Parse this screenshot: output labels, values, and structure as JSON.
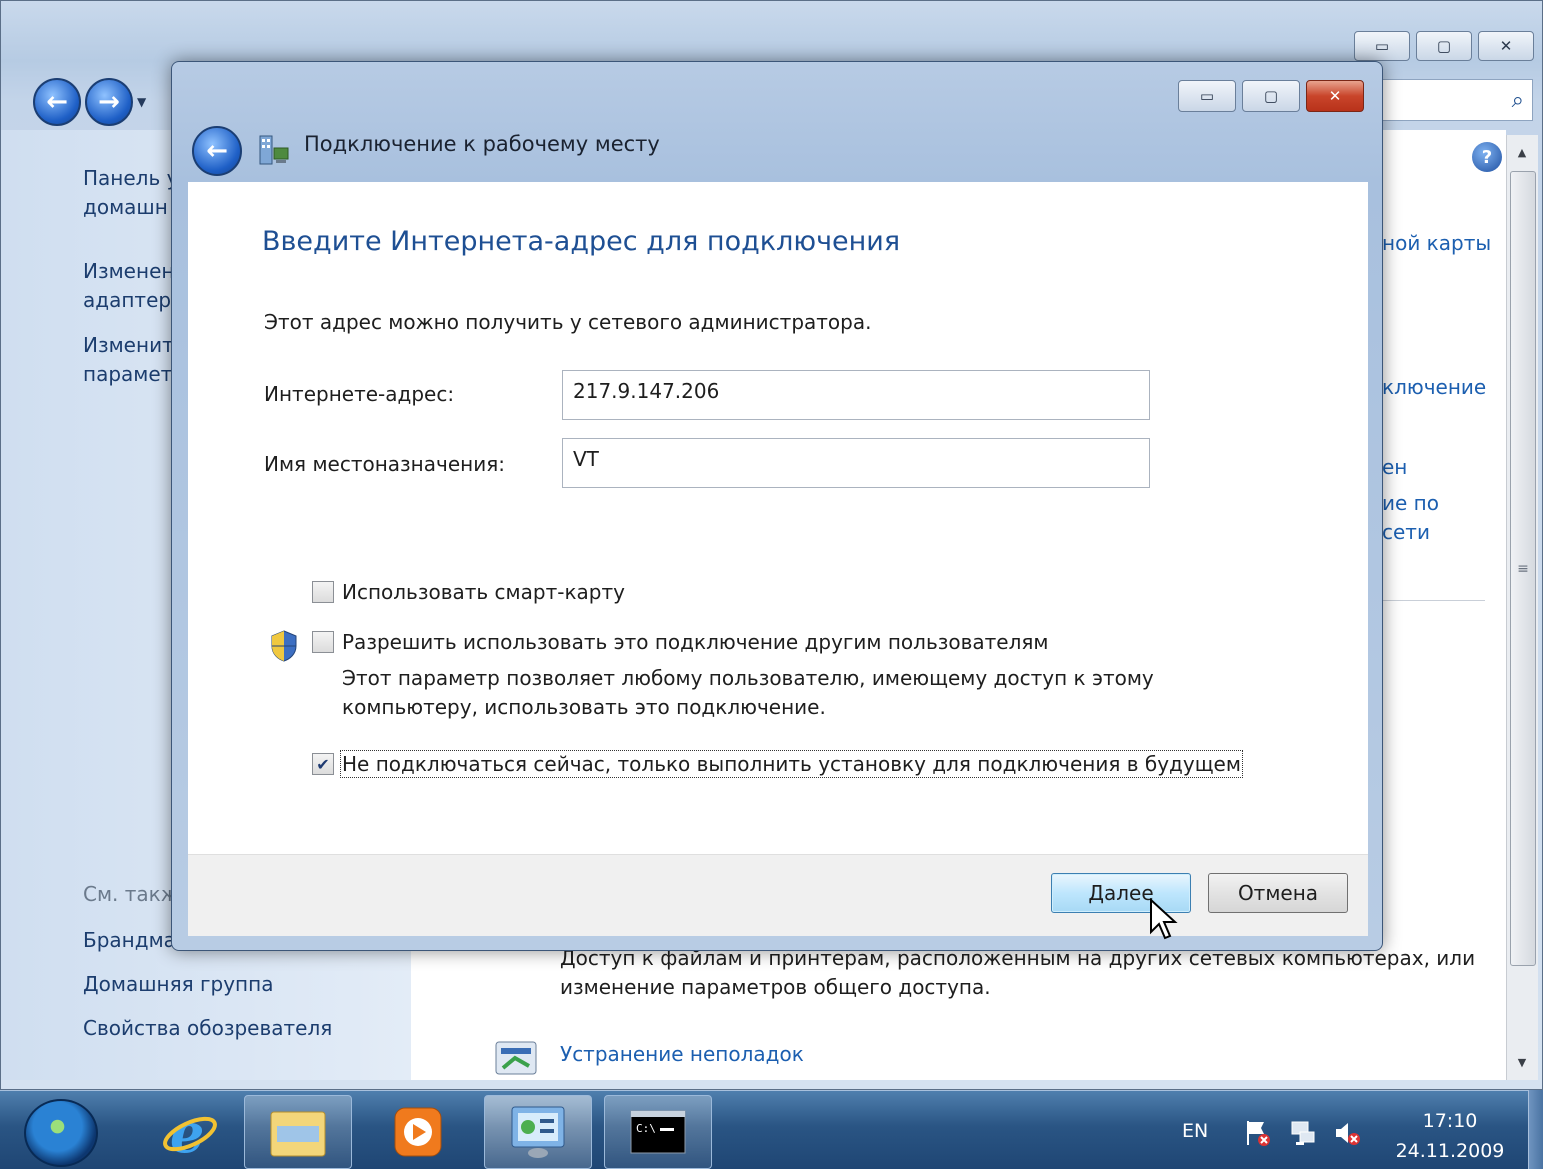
{
  "background_window": {
    "sidebar_links": [
      {
        "label": "Панель у"
      },
      {
        "label": "домашн"
      },
      {
        "label": "Изменен"
      },
      {
        "label": "адаптера"
      },
      {
        "label": "Изменит"
      },
      {
        "label": "парамет"
      }
    ],
    "see_also_label": "См. такж",
    "see_also_links": [
      {
        "label": "Брандма"
      },
      {
        "label": "Домашняя группа"
      },
      {
        "label": "Свойства обозревателя"
      }
    ],
    "right_fragments": [
      "ной карты",
      "ключение",
      "ен",
      "ие по",
      "сети"
    ],
    "content_text_line1": "Доступ к файлам и принтерам, расположенным на других сетевых компьютерах, или",
    "content_text_line2": "изменение параметров общего доступа.",
    "troubleshoot_link": "Устранение неполадок"
  },
  "dialog": {
    "title": "Подключение к рабочему месту",
    "heading": "Введите Интернета-адрес для подключения",
    "description": "Этот адрес можно получить у сетевого администратора.",
    "address_label": "Интернете-адрес:",
    "address_value": "217.9.147.206",
    "destination_label": "Имя местоназначения:",
    "destination_value": "VT",
    "checkbox_smartcard": {
      "label": "Использовать смарт-карту",
      "checked": false
    },
    "checkbox_allow_others": {
      "label": "Разрешить использовать это подключение другим пользователям",
      "checked": false
    },
    "allow_others_note_line1": "Этот параметр позволяет любому пользователю, имеющему доступ к этому",
    "allow_others_note_line2": "компьютеру, использовать это подключение.",
    "checkbox_dont_connect": {
      "label": "Не подключаться сейчас, только выполнить установку для подключения в будущем",
      "checked": true
    },
    "next_button": "Далее",
    "cancel_button": "Отмена"
  },
  "taskbar": {
    "language": "EN",
    "time": "17:10",
    "date": "24.11.2009",
    "items": [
      "internet-explorer",
      "windows-explorer",
      "media-player",
      "control-panel",
      "command-prompt"
    ]
  },
  "colors": {
    "heading": "#1e4f93",
    "link": "#1c5fb0",
    "close_button": "#c9452b"
  }
}
